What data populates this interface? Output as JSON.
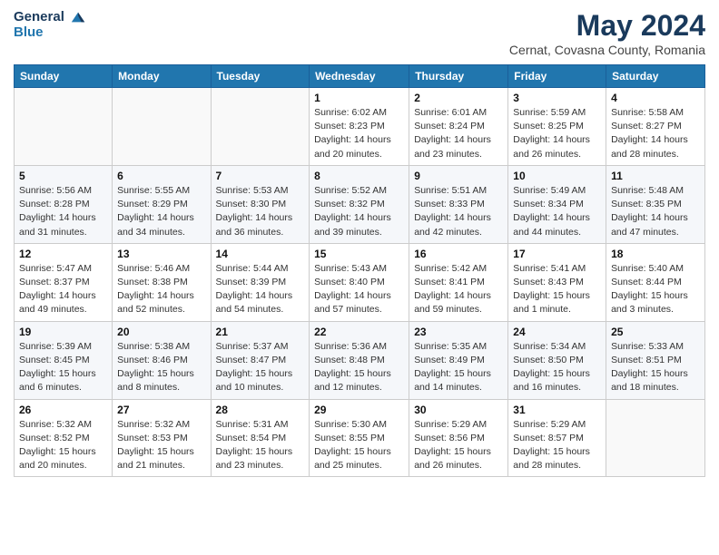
{
  "logo": {
    "general": "General",
    "blue": "Blue"
  },
  "header": {
    "title": "May 2024",
    "subtitle": "Cernat, Covasna County, Romania"
  },
  "weekdays": [
    "Sunday",
    "Monday",
    "Tuesday",
    "Wednesday",
    "Thursday",
    "Friday",
    "Saturday"
  ],
  "weeks": [
    [
      {
        "day": "",
        "info": ""
      },
      {
        "day": "",
        "info": ""
      },
      {
        "day": "",
        "info": ""
      },
      {
        "day": "1",
        "info": "Sunrise: 6:02 AM\nSunset: 8:23 PM\nDaylight: 14 hours\nand 20 minutes."
      },
      {
        "day": "2",
        "info": "Sunrise: 6:01 AM\nSunset: 8:24 PM\nDaylight: 14 hours\nand 23 minutes."
      },
      {
        "day": "3",
        "info": "Sunrise: 5:59 AM\nSunset: 8:25 PM\nDaylight: 14 hours\nand 26 minutes."
      },
      {
        "day": "4",
        "info": "Sunrise: 5:58 AM\nSunset: 8:27 PM\nDaylight: 14 hours\nand 28 minutes."
      }
    ],
    [
      {
        "day": "5",
        "info": "Sunrise: 5:56 AM\nSunset: 8:28 PM\nDaylight: 14 hours\nand 31 minutes."
      },
      {
        "day": "6",
        "info": "Sunrise: 5:55 AM\nSunset: 8:29 PM\nDaylight: 14 hours\nand 34 minutes."
      },
      {
        "day": "7",
        "info": "Sunrise: 5:53 AM\nSunset: 8:30 PM\nDaylight: 14 hours\nand 36 minutes."
      },
      {
        "day": "8",
        "info": "Sunrise: 5:52 AM\nSunset: 8:32 PM\nDaylight: 14 hours\nand 39 minutes."
      },
      {
        "day": "9",
        "info": "Sunrise: 5:51 AM\nSunset: 8:33 PM\nDaylight: 14 hours\nand 42 minutes."
      },
      {
        "day": "10",
        "info": "Sunrise: 5:49 AM\nSunset: 8:34 PM\nDaylight: 14 hours\nand 44 minutes."
      },
      {
        "day": "11",
        "info": "Sunrise: 5:48 AM\nSunset: 8:35 PM\nDaylight: 14 hours\nand 47 minutes."
      }
    ],
    [
      {
        "day": "12",
        "info": "Sunrise: 5:47 AM\nSunset: 8:37 PM\nDaylight: 14 hours\nand 49 minutes."
      },
      {
        "day": "13",
        "info": "Sunrise: 5:46 AM\nSunset: 8:38 PM\nDaylight: 14 hours\nand 52 minutes."
      },
      {
        "day": "14",
        "info": "Sunrise: 5:44 AM\nSunset: 8:39 PM\nDaylight: 14 hours\nand 54 minutes."
      },
      {
        "day": "15",
        "info": "Sunrise: 5:43 AM\nSunset: 8:40 PM\nDaylight: 14 hours\nand 57 minutes."
      },
      {
        "day": "16",
        "info": "Sunrise: 5:42 AM\nSunset: 8:41 PM\nDaylight: 14 hours\nand 59 minutes."
      },
      {
        "day": "17",
        "info": "Sunrise: 5:41 AM\nSunset: 8:43 PM\nDaylight: 15 hours\nand 1 minute."
      },
      {
        "day": "18",
        "info": "Sunrise: 5:40 AM\nSunset: 8:44 PM\nDaylight: 15 hours\nand 3 minutes."
      }
    ],
    [
      {
        "day": "19",
        "info": "Sunrise: 5:39 AM\nSunset: 8:45 PM\nDaylight: 15 hours\nand 6 minutes."
      },
      {
        "day": "20",
        "info": "Sunrise: 5:38 AM\nSunset: 8:46 PM\nDaylight: 15 hours\nand 8 minutes."
      },
      {
        "day": "21",
        "info": "Sunrise: 5:37 AM\nSunset: 8:47 PM\nDaylight: 15 hours\nand 10 minutes."
      },
      {
        "day": "22",
        "info": "Sunrise: 5:36 AM\nSunset: 8:48 PM\nDaylight: 15 hours\nand 12 minutes."
      },
      {
        "day": "23",
        "info": "Sunrise: 5:35 AM\nSunset: 8:49 PM\nDaylight: 15 hours\nand 14 minutes."
      },
      {
        "day": "24",
        "info": "Sunrise: 5:34 AM\nSunset: 8:50 PM\nDaylight: 15 hours\nand 16 minutes."
      },
      {
        "day": "25",
        "info": "Sunrise: 5:33 AM\nSunset: 8:51 PM\nDaylight: 15 hours\nand 18 minutes."
      }
    ],
    [
      {
        "day": "26",
        "info": "Sunrise: 5:32 AM\nSunset: 8:52 PM\nDaylight: 15 hours\nand 20 minutes."
      },
      {
        "day": "27",
        "info": "Sunrise: 5:32 AM\nSunset: 8:53 PM\nDaylight: 15 hours\nand 21 minutes."
      },
      {
        "day": "28",
        "info": "Sunrise: 5:31 AM\nSunset: 8:54 PM\nDaylight: 15 hours\nand 23 minutes."
      },
      {
        "day": "29",
        "info": "Sunrise: 5:30 AM\nSunset: 8:55 PM\nDaylight: 15 hours\nand 25 minutes."
      },
      {
        "day": "30",
        "info": "Sunrise: 5:29 AM\nSunset: 8:56 PM\nDaylight: 15 hours\nand 26 minutes."
      },
      {
        "day": "31",
        "info": "Sunrise: 5:29 AM\nSunset: 8:57 PM\nDaylight: 15 hours\nand 28 minutes."
      },
      {
        "day": "",
        "info": ""
      }
    ]
  ],
  "colors": {
    "header_bg": "#2176ae",
    "header_text": "#ffffff",
    "title_color": "#1a3a5c"
  }
}
